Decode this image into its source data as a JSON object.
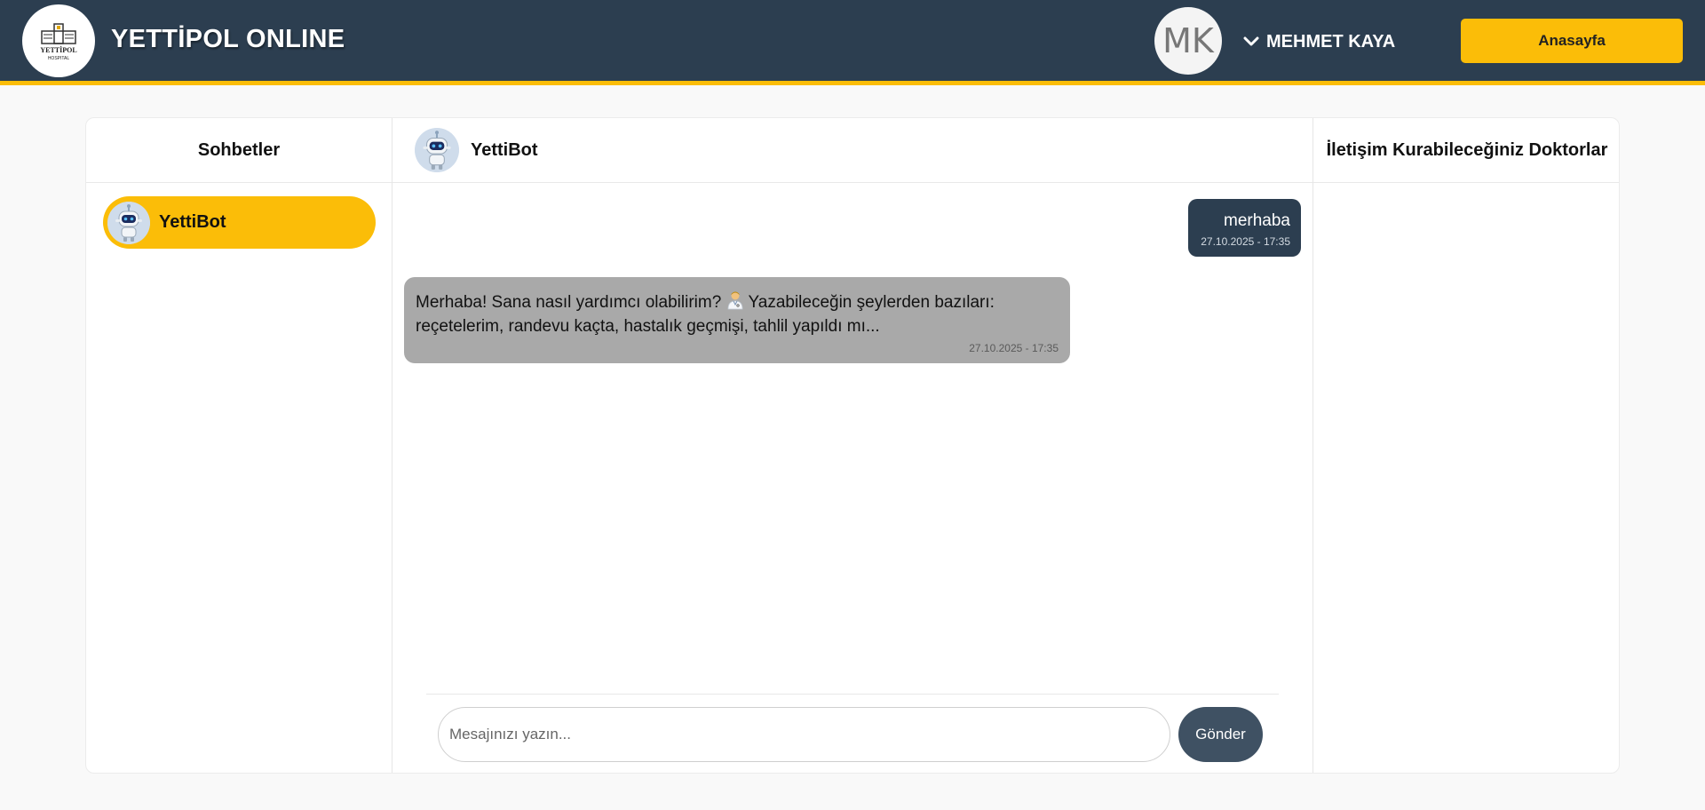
{
  "header": {
    "logo": {
      "text": "YETTİPOL",
      "subtext": "HOSPITAL"
    },
    "title": "YETTİPOL ONLINE",
    "user_initials": "MK",
    "user_name": "MEHMET KAYA",
    "home_button": "Anasayfa"
  },
  "sidebar": {
    "title": "Sohbetler",
    "chats": [
      {
        "name": "YettiBot",
        "active": true
      }
    ]
  },
  "chat": {
    "bot_name": "YettiBot",
    "messages": [
      {
        "direction": "outgoing",
        "text": "merhaba",
        "time": "27.10.2025 - 17:35"
      },
      {
        "direction": "incoming",
        "text_before_emoji": "Merhaba! Sana nasıl yardımcı olabilirim?",
        "emoji": "doctor-emoji",
        "text_after_emoji": "Yazabileceğin şeylerden bazıları: reçetelerim, randevu kaçta, hastalık geçmişi, tahlil yapıldı mı...",
        "time": "27.10.2025 - 17:35"
      }
    ],
    "input_placeholder": "Mesajınızı yazın...",
    "send_button": "Gönder"
  },
  "doctors_panel": {
    "title": "İletişim Kurabileceğiniz Doktorlar",
    "doctors": []
  },
  "colors": {
    "header_bg": "#2c3e50",
    "accent": "#fbbd08",
    "outgoing_bubble": "#2c3e50",
    "incoming_bubble": "#a9a9a9",
    "send_button": "#3f5163"
  }
}
